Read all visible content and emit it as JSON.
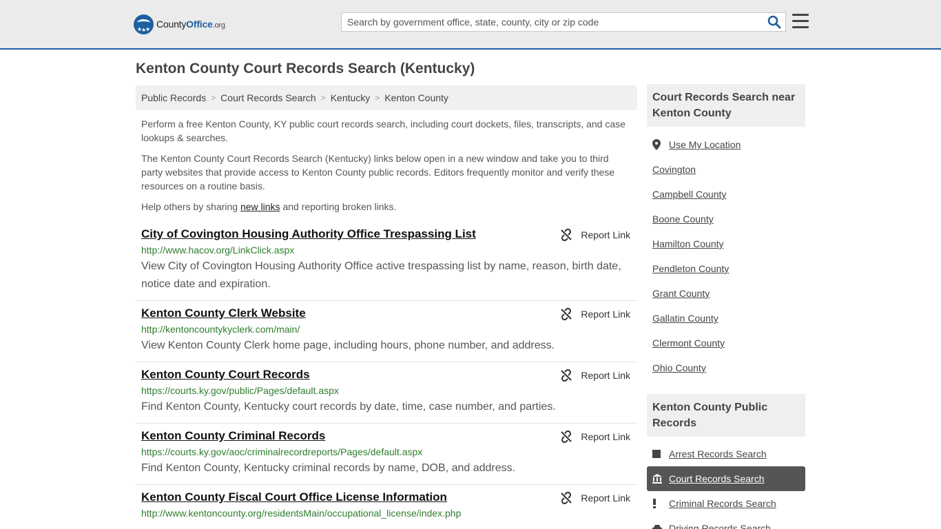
{
  "header": {
    "logo_county": "County",
    "logo_office": "Office",
    "logo_org": ".org",
    "search_placeholder": "Search by government office, state, county, city or zip code"
  },
  "page_title": "Kenton County Court Records Search (Kentucky)",
  "breadcrumb": [
    "Public Records",
    "Court Records Search",
    "Kentucky",
    "Kenton County"
  ],
  "intro": {
    "p1": "Perform a free Kenton County, KY public court records search, including court dockets, files, transcripts, and case lookups & searches.",
    "p2": "The Kenton County Court Records Search (Kentucky) links below open in a new window and take you to third party websites that provide access to Kenton County public records. Editors frequently monitor and verify these resources on a routine basis.",
    "p3_before": "Help others by sharing ",
    "p3_link": "new links",
    "p3_after": " and reporting broken links."
  },
  "report_label": "Report Link",
  "results": [
    {
      "title": "City of Covington Housing Authority Office Trespassing List",
      "url": "http://www.hacov.org/LinkClick.aspx",
      "desc": "View City of Covington Housing Authority Office active trespassing list by name, reason, birth date, notice date and expiration."
    },
    {
      "title": "Kenton County Clerk Website",
      "url": "http://kentoncountykyclerk.com/main/",
      "desc": "View Kenton County Clerk home page, including hours, phone number, and address."
    },
    {
      "title": "Kenton County Court Records",
      "url": "https://courts.ky.gov/public/Pages/default.aspx",
      "desc": "Find Kenton County, Kentucky court records by date, time, case number, and parties."
    },
    {
      "title": "Kenton County Criminal Records",
      "url": "https://courts.ky.gov/aoc/criminalrecordreports/Pages/default.aspx",
      "desc": "Find Kenton County, Kentucky criminal records by name, DOB, and address."
    },
    {
      "title": "Kenton County Fiscal Court Office License Information",
      "url": "http://www.kentoncounty.org/residentsMain/occupational_license/index.php",
      "desc": ""
    }
  ],
  "sidebar": {
    "nearby_heading": "Court Records Search near Kenton County",
    "nearby": [
      "Use My Location",
      "Covington",
      "Campbell County",
      "Boone County",
      "Hamilton County",
      "Pendleton County",
      "Grant County",
      "Gallatin County",
      "Clermont County",
      "Ohio County"
    ],
    "public_heading": "Kenton County Public Records",
    "public": [
      {
        "label": "Arrest Records Search",
        "icon": "square-icon",
        "active": false
      },
      {
        "label": "Court Records Search",
        "icon": "courthouse-icon",
        "active": true
      },
      {
        "label": "Criminal Records Search",
        "icon": "exclamation-icon",
        "active": false
      },
      {
        "label": "Driving Records Search",
        "icon": "car-icon",
        "active": false
      }
    ]
  },
  "colors": {
    "brand_blue": "#1f5fa0",
    "url_green": "#2e7d2e",
    "active_bg": "#555555"
  }
}
